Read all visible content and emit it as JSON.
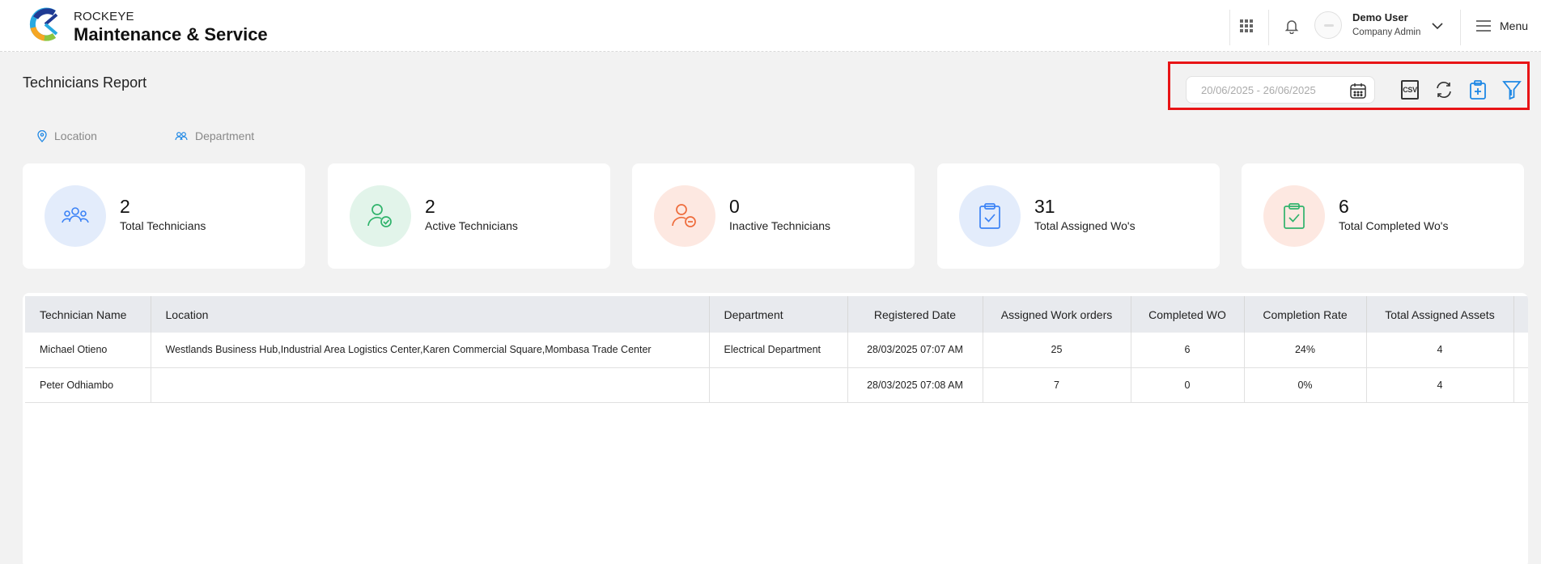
{
  "app": {
    "brand_top": "ROCKEYE",
    "brand_main": "Maintenance & Service"
  },
  "header": {
    "user_name": "Demo User",
    "user_role": "Company Admin",
    "menu_label": "Menu"
  },
  "page": {
    "title": "Technicians Report",
    "date_range_placeholder": "20/06/2025 - 26/06/2025",
    "csv_label": "CSV"
  },
  "filters": {
    "location": "Location",
    "department": "Department"
  },
  "stats": [
    {
      "value": "2",
      "label": "Total Technicians",
      "icon": "people-group-icon",
      "bg": "#e3ecfb",
      "color": "#3b82f6"
    },
    {
      "value": "2",
      "label": "Active Technicians",
      "icon": "user-check-icon",
      "bg": "#e2f4ea",
      "color": "#2fb36b"
    },
    {
      "value": "0",
      "label": "Inactive Technicians",
      "icon": "user-minus-icon",
      "bg": "#fde8e1",
      "color": "#ee6b3b"
    },
    {
      "value": "31",
      "label": "Total Assigned Wo's",
      "icon": "clipboard-check-icon",
      "bg": "#e3ecfb",
      "color": "#3b82f6"
    },
    {
      "value": "6",
      "label": "Total Completed Wo's",
      "icon": "clipboard-check-icon",
      "bg": "#fde8e1",
      "color": "#2fb36b"
    }
  ],
  "table": {
    "columns": [
      "Technician Name",
      "Location",
      "Department",
      "Registered Date",
      "Assigned Work orders",
      "Completed WO",
      "Completion Rate",
      "Total Assigned Assets"
    ],
    "rows": [
      [
        "Michael Otieno",
        "Westlands Business Hub,Industrial Area Logistics Center,Karen Commercial Square,Mombasa Trade Center",
        "Electrical Department",
        "28/03/2025 07:07 AM",
        "25",
        "6",
        "24%",
        "4"
      ],
      [
        "Peter Odhiambo",
        "",
        "",
        "28/03/2025 07:08 AM",
        "7",
        "0",
        "0%",
        "4"
      ]
    ]
  },
  "colors": {
    "accent": "#1e88e5",
    "highlight_outline": "#e81416"
  }
}
